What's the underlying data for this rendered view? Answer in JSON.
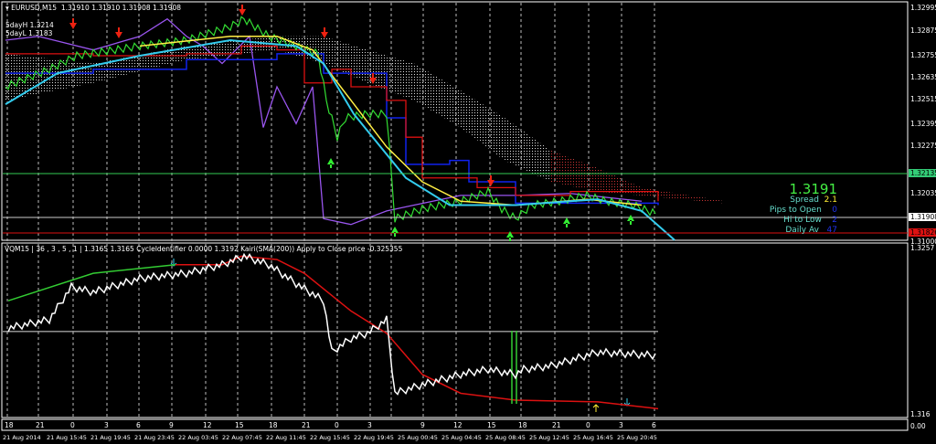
{
  "header": {
    "symbol_label": "EURUSD,M15",
    "ohlc": "1.31910 1.31910 1.31908 1.31908",
    "day_high": "5dayH 1.3214",
    "day_low": "5dayL 1.3183"
  },
  "info_panel": {
    "price": "1.3191",
    "spread_label": "Spread",
    "spread_value": "2.1",
    "pips_label": "Pips to Open",
    "pips_value": "0",
    "hilo_label": "Hi to Low",
    "hilo_value": "2",
    "daily_label": "Daily Av",
    "daily_value": "47"
  },
  "price_axis": {
    "labels": [
      "1.32995",
      "1.32875",
      "1.32755",
      "1.32635",
      "1.32515",
      "1.32395",
      "1.32275",
      "1.32035",
      "1.31000"
    ],
    "green_line": "1.32135",
    "bid_line": "1.31908",
    "red_line": "1.31826"
  },
  "sub_window": {
    "title": "VQM15 | 36 , 3 , 5 , 1  |  1.3165 1.3165  CycleIdentifier 0.0000 1.3192  Kairi(SMA(200)) Apply to Close price -0.325355",
    "top_label": "1.3257",
    "bottom_label": "1.316",
    "zero_label": "0.00"
  },
  "time_axis": {
    "hours": [
      "18",
      "21",
      "0",
      "3",
      "6",
      "9",
      "12",
      "15",
      "18",
      "21",
      "0",
      "3",
      "9",
      "12",
      "15",
      "18",
      "21",
      "0",
      "3",
      "6"
    ],
    "dates": [
      "21 Aug 2014",
      "21 Aug 15:45",
      "21 Aug 19:45",
      "21 Aug 23:45",
      "22 Aug 03:45",
      "22 Aug 07:45",
      "22 Aug 11:45",
      "22 Aug 15:45",
      "22 Aug 19:45",
      "25 Aug 00:45",
      "25 Aug 04:45",
      "25 Aug 08:45",
      "25 Aug 12:45",
      "25 Aug 16:45",
      "25 Aug 20:45"
    ]
  },
  "colors": {
    "price": "#33dd33",
    "yellow_ma": "#ffee44",
    "cyan_ma": "#33ccee",
    "purple": "#9955ee",
    "red_step": "#dd1111",
    "blue_step": "#1122ee",
    "osc_white": "#ffffff",
    "osc_red": "#dd1111",
    "osc_green": "#33cc33"
  },
  "chart_data": [
    {
      "type": "line",
      "title": "EURUSD,M15",
      "x_unit": "bar",
      "ylim": [
        1.318,
        1.3302
      ],
      "series": [
        {
          "name": "price",
          "x": [
            1,
            17,
            27,
            50,
            67,
            83,
            88,
            97,
            107,
            115,
            118,
            122,
            125,
            133,
            140,
            143,
            153,
            167,
            177,
            182,
            187,
            193,
            203,
            213,
            220,
            230,
            239
          ],
          "y": [
            1.3259,
            1.3268,
            1.3275,
            1.328,
            1.3283,
            1.329,
            1.3294,
            1.3285,
            1.328,
            1.3276,
            1.3252,
            1.3233,
            1.3243,
            1.3245,
            1.3245,
            1.3191,
            1.3196,
            1.32,
            1.3205,
            1.3196,
            1.3191,
            1.3198,
            1.32,
            1.3203,
            1.32,
            1.3198,
            1.3193
          ]
        },
        {
          "name": "yellow_ma",
          "x": [
            50,
            83,
            100,
            113,
            127,
            140,
            153,
            167,
            187,
            213,
            233
          ],
          "y": [
            1.328,
            1.3285,
            1.3285,
            1.3278,
            1.3252,
            1.3228,
            1.321,
            1.32,
            1.3198,
            1.3201,
            1.3198
          ]
        },
        {
          "name": "cyan_ma",
          "x": [
            1,
            20,
            50,
            83,
            107,
            117,
            128,
            147,
            163,
            187,
            217,
            233,
            245
          ],
          "y": [
            1.325,
            1.3266,
            1.3275,
            1.3283,
            1.328,
            1.3271,
            1.3245,
            1.3212,
            1.3198,
            1.3198,
            1.3201,
            1.3195,
            1.318
          ]
        },
        {
          "name": "purple",
          "x": [
            1,
            13,
            33,
            50,
            60,
            67,
            73,
            80,
            90,
            95,
            100,
            107,
            113,
            117,
            127,
            140,
            150,
            167,
            187,
            207,
            233
          ],
          "y": [
            1.3283,
            1.3285,
            1.3278,
            1.3285,
            1.3294,
            1.3285,
            1.328,
            1.3271,
            1.3285,
            1.3238,
            1.3259,
            1.324,
            1.3259,
            1.3191,
            1.3188,
            1.3195,
            1.3198,
            1.3203,
            1.3203,
            1.3204,
            1.32
          ]
        },
        {
          "name": "red_step",
          "x": [
            1,
            33,
            67,
            87,
            100,
            110,
            120,
            127,
            140,
            147,
            153,
            173,
            187,
            207,
            239
          ],
          "y": [
            1.3276,
            1.3275,
            1.3276,
            1.328,
            1.3278,
            1.3261,
            1.3268,
            1.3259,
            1.3252,
            1.3233,
            1.3212,
            1.3207,
            1.3203,
            1.3205,
            1.32
          ]
        },
        {
          "name": "blue_step",
          "x": [
            1,
            33,
            67,
            100,
            117,
            140,
            147,
            163,
            170,
            187,
            239
          ],
          "y": [
            1.3266,
            1.3268,
            1.3273,
            1.3276,
            1.3266,
            1.3243,
            1.3219,
            1.3221,
            1.321,
            1.3199,
            1.3198
          ]
        },
        {
          "name": "cloud_upper",
          "x": [
            1,
            33,
            67,
            100,
            117,
            133,
            150,
            167,
            183,
            200,
            217,
            233,
            263
          ],
          "y": [
            1.3276,
            1.3271,
            1.328,
            1.3285,
            1.3285,
            1.3278,
            1.3271,
            1.3257,
            1.3243,
            1.3226,
            1.3217,
            1.3207,
            1.32
          ]
        },
        {
          "name": "cloud_lower",
          "x": [
            1,
            33,
            67,
            100,
            117,
            133,
            150,
            167,
            183,
            200,
            217,
            233,
            263
          ],
          "y": [
            1.3252,
            1.3261,
            1.3273,
            1.3278,
            1.3271,
            1.3261,
            1.3252,
            1.3238,
            1.3221,
            1.321,
            1.3205,
            1.3203,
            1.3199
          ]
        }
      ]
    },
    {
      "type": "line",
      "title": "VQM15",
      "x_unit": "bar",
      "ylim": [
        1.3157,
        1.3257
      ],
      "series": [
        {
          "name": "osc_white",
          "x": [
            2,
            17,
            25,
            33,
            50,
            67,
            80,
            88,
            97,
            107,
            117,
            120,
            127,
            133,
            140,
            143,
            153,
            167,
            177,
            187,
            190,
            200,
            217,
            239
          ],
          "y": [
            1.321,
            1.3215,
            1.3234,
            1.3231,
            1.3239,
            1.3242,
            1.3247,
            1.3252,
            1.3247,
            1.3236,
            1.3226,
            1.3196,
            1.3204,
            1.3207,
            1.3215,
            1.3172,
            1.3177,
            1.3183,
            1.3186,
            1.3183,
            1.3186,
            1.3188,
            1.3196,
            1.3194
          ]
        },
        {
          "name": "osc_signal",
          "x": [
            2,
            33,
            63,
            80,
            87,
            100,
            110,
            127,
            140,
            153,
            167,
            187,
            217,
            239
          ],
          "y": [
            1.3226,
            1.3242,
            1.3247,
            1.3247,
            1.3252,
            1.325,
            1.3242,
            1.322,
            1.3207,
            1.3183,
            1.3172,
            1.3168,
            1.3167,
            1.3163
          ]
        },
        {
          "name": "level",
          "x": [
            0,
            239
          ],
          "y": [
            1.3208,
            1.3208
          ]
        }
      ]
    }
  ]
}
